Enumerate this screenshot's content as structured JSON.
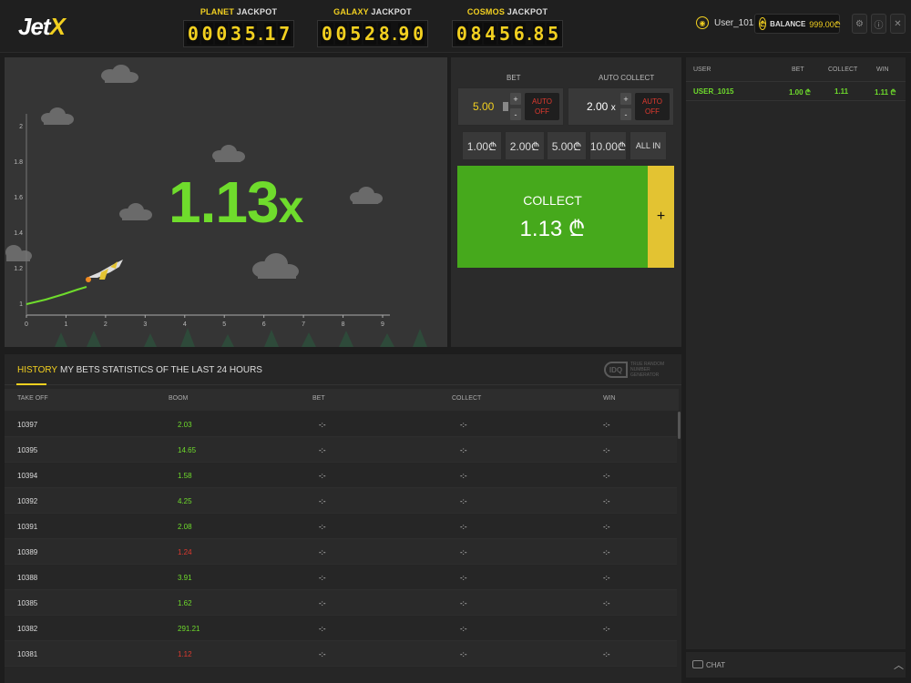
{
  "header": {
    "logo_main": "Jet",
    "logo_x": "X",
    "jackpots": [
      {
        "name": "PLANET",
        "suffix": "JACKPOT",
        "digits": [
          "0",
          "0",
          "0",
          "3",
          "5",
          ".",
          "1",
          "7"
        ]
      },
      {
        "name": "GALAXY",
        "suffix": "JACKPOT",
        "digits": [
          "0",
          "0",
          "5",
          "2",
          "8",
          ".",
          "9",
          "0"
        ]
      },
      {
        "name": "COSMOS",
        "suffix": "JACKPOT",
        "digits": [
          "0",
          "8",
          "4",
          "5",
          "6",
          ".",
          "8",
          "5"
        ]
      }
    ],
    "username": "User_1015",
    "balance_label": "BALANCE",
    "balance_value": "999.00₾",
    "currency_symbol": "₾"
  },
  "game": {
    "multiplier_value": "1.13",
    "multiplier_unit": "x",
    "axis_x_ticks": [
      "0",
      "1",
      "2",
      "3",
      "4",
      "5",
      "6",
      "7",
      "8",
      "9"
    ],
    "axis_y_ticks": [
      "1",
      "1.2",
      "1.4",
      "1.6",
      "1.8",
      "2"
    ]
  },
  "bet_panel": {
    "bet_label": "BET",
    "bet_value": "5.00",
    "auto_collect_label": "AUTO COLLECT",
    "auto_collect_value": "2.00",
    "auto_collect_unit": "x",
    "auto_line1": "AUTO",
    "auto_line2": "OFF",
    "plus": "+",
    "minus": "-",
    "chips": [
      "1.00₾",
      "2.00₾",
      "5.00₾",
      "10.00₾",
      "ALL IN"
    ],
    "collect_label": "COLLECT",
    "collect_amount": "1.13 ₾",
    "add_bet": "+"
  },
  "history": {
    "tabs": [
      "HISTORY",
      "MY BETS",
      "STATISTICS OF THE LAST 24 HOURS"
    ],
    "rng_logo": "IDQ",
    "rng_text": "TRUE RANDOM NUMBER GENERATOR",
    "columns": [
      "TAKE OFF",
      "BOOM",
      "BET",
      "COLLECT",
      "WIN"
    ],
    "rows": [
      {
        "takeoff": "10397",
        "boom": "2.03",
        "bet": "-:-",
        "collect": "-:-",
        "win": "-:-",
        "low": false
      },
      {
        "takeoff": "10395",
        "boom": "14.65",
        "bet": "-:-",
        "collect": "-:-",
        "win": "-:-",
        "low": false
      },
      {
        "takeoff": "10394",
        "boom": "1.58",
        "bet": "-:-",
        "collect": "-:-",
        "win": "-:-",
        "low": false
      },
      {
        "takeoff": "10392",
        "boom": "4.25",
        "bet": "-:-",
        "collect": "-:-",
        "win": "-:-",
        "low": false
      },
      {
        "takeoff": "10391",
        "boom": "2.08",
        "bet": "-:-",
        "collect": "-:-",
        "win": "-:-",
        "low": false
      },
      {
        "takeoff": "10389",
        "boom": "1.24",
        "bet": "-:-",
        "collect": "-:-",
        "win": "-:-",
        "low": true
      },
      {
        "takeoff": "10388",
        "boom": "3.91",
        "bet": "-:-",
        "collect": "-:-",
        "win": "-:-",
        "low": false
      },
      {
        "takeoff": "10385",
        "boom": "1.62",
        "bet": "-:-",
        "collect": "-:-",
        "win": "-:-",
        "low": false
      },
      {
        "takeoff": "10382",
        "boom": "291.21",
        "bet": "-:-",
        "collect": "-:-",
        "win": "-:-",
        "low": false
      },
      {
        "takeoff": "10381",
        "boom": "1.12",
        "bet": "-:-",
        "collect": "-:-",
        "win": "-:-",
        "low": true
      }
    ]
  },
  "players": {
    "columns": [
      "USER",
      "BET",
      "COLLECT",
      "WIN"
    ],
    "rows": [
      {
        "user": "USER_1015",
        "bet": "1.00 ₾",
        "collect": "1.11",
        "win": "1.11 ₾"
      }
    ]
  },
  "chat": {
    "label": "CHAT"
  },
  "colors": {
    "accent": "#f2d020",
    "green": "#46a91c",
    "multiplier": "#6fdc2c",
    "loss": "#e03a2f"
  }
}
